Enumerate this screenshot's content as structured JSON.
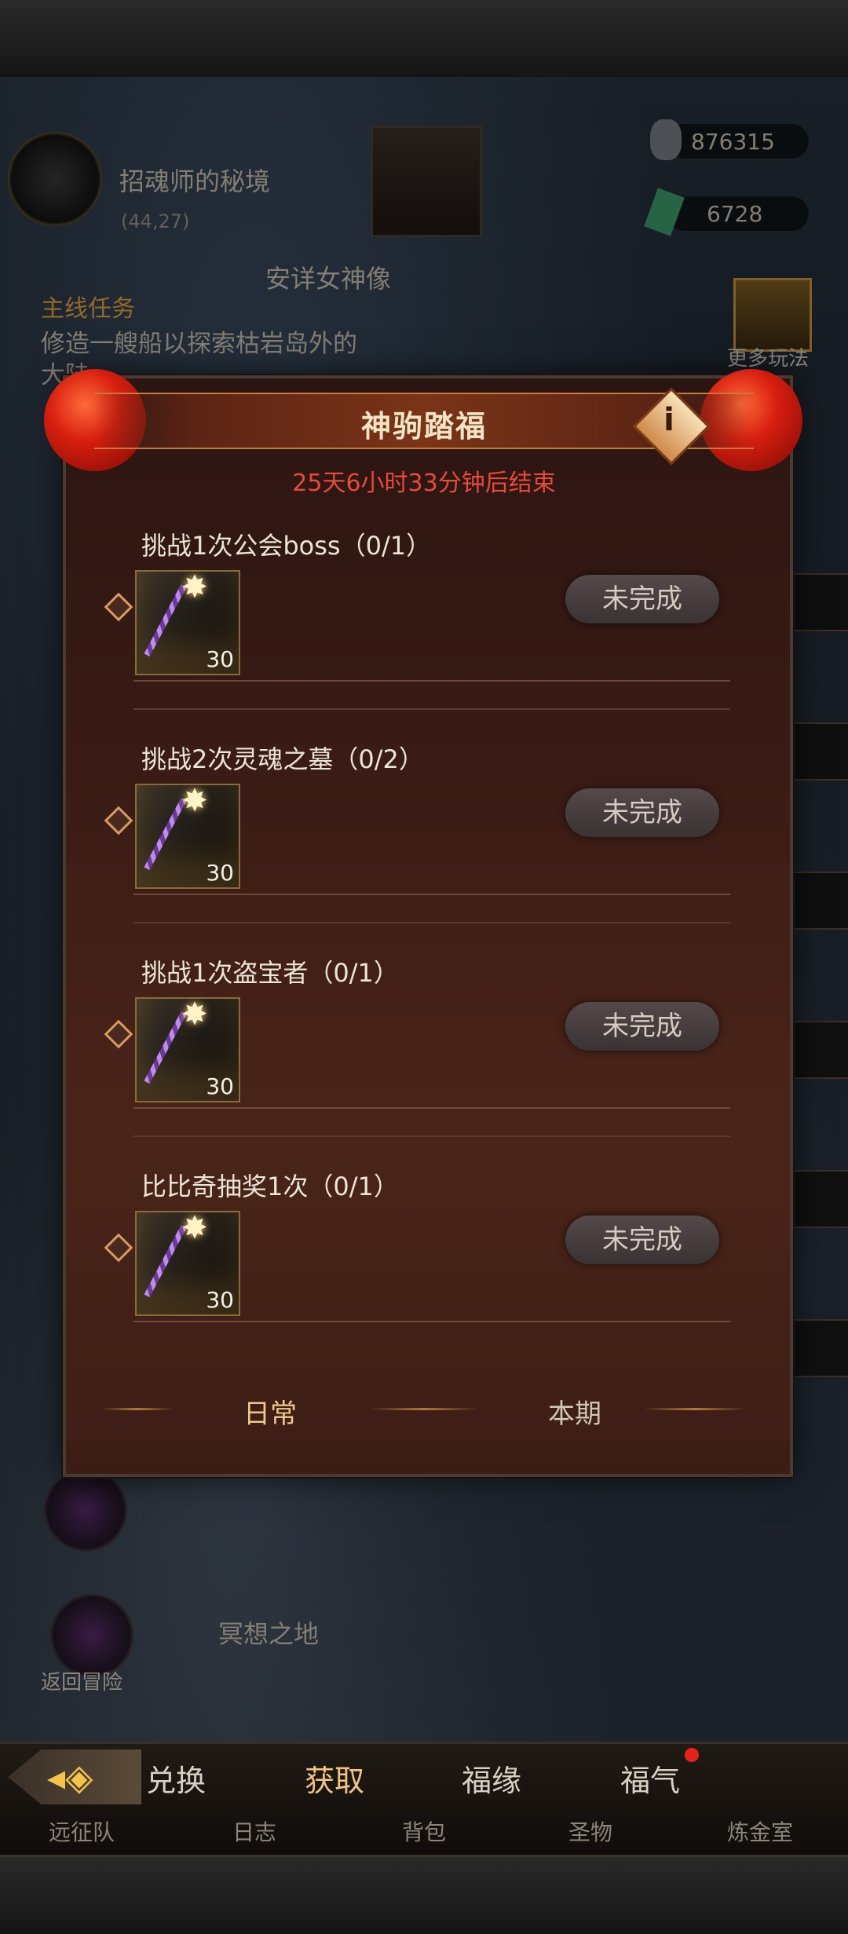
{
  "location": {
    "name": "招魂师的秘境",
    "coords": "(44,27)",
    "statue": "安详女神像",
    "meditation": "冥想之地"
  },
  "resources": {
    "stone": "876315",
    "gem": "6728"
  },
  "more_label": "更多玩法",
  "quest": {
    "header": "主线任务",
    "text": "修造一艘船以探索枯岩岛外的大陆"
  },
  "return_label": "返回冒险",
  "dialog": {
    "title": "神驹踏福",
    "timer": "25天6小时33分钟后结束",
    "info_glyph": "i",
    "tasks": [
      {
        "title": "挑战1次公会boss（0/1）",
        "reward_count": "30",
        "status": "未完成"
      },
      {
        "title": "挑战2次灵魂之墓（0/2）",
        "reward_count": "30",
        "status": "未完成"
      },
      {
        "title": "挑战1次盗宝者（0/1）",
        "reward_count": "30",
        "status": "未完成"
      },
      {
        "title": "比比奇抽奖1次（0/1）",
        "reward_count": "30",
        "status": "未完成"
      }
    ],
    "tabs": [
      "日常",
      "本期"
    ]
  },
  "bottom_tabs": [
    "兑换",
    "获取",
    "福缘",
    "福气"
  ],
  "bottom_nav": [
    "远征队",
    "日志",
    "背包",
    "圣物",
    "炼金室"
  ],
  "colors": {
    "accent": "#f2c47e",
    "timer": "#e64a3a",
    "badge": "#e8201a"
  }
}
